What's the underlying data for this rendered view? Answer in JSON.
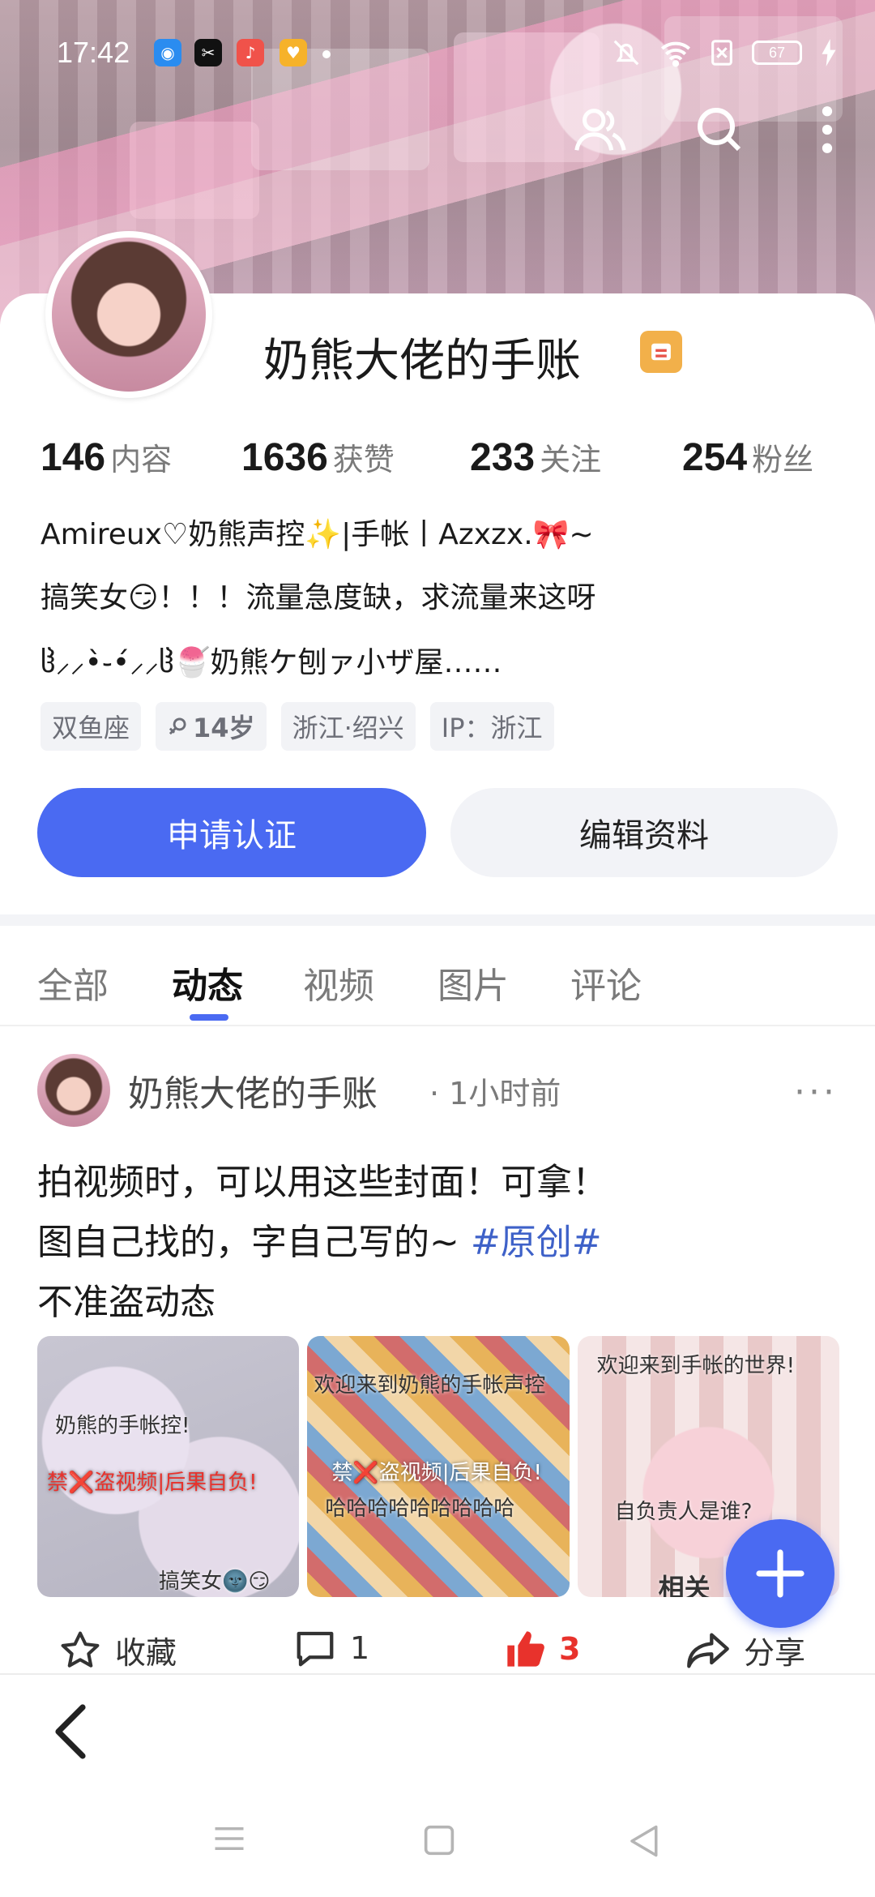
{
  "status_bar": {
    "time": "17:42",
    "battery": "67",
    "icons": [
      "mute-icon",
      "wifi-icon",
      "sim-icon",
      "battery-icon",
      "charging-icon"
    ],
    "app_icons": [
      "browser-app-icon",
      "capcut-app-icon",
      "music-app-icon",
      "heart-app-icon"
    ]
  },
  "header": {
    "actions": [
      "friends-icon",
      "search-icon",
      "more-vert-icon"
    ]
  },
  "profile": {
    "name": "奶熊大佬的手账",
    "stats": [
      {
        "value": "146",
        "label": "内容"
      },
      {
        "value": "1636",
        "label": "获赞"
      },
      {
        "value": "233",
        "label": "关注"
      },
      {
        "value": "254",
        "label": "粉丝"
      }
    ],
    "bio": [
      "Amireux♡奶熊声控✨|手帐丨Azxzx.🎀~",
      "搞笑女😏！！！流量急度缺，求流量来这呀",
      "ჱ̒⸝⸝•̀֊•́⸝⸝ჱ̒🍧奶熊ケ刨ァ小ザ屋……"
    ],
    "tags": [
      {
        "label": "双鱼座"
      },
      {
        "label": "14岁",
        "icon": "gender-icon"
      },
      {
        "label": "浙江·绍兴"
      },
      {
        "label": "IP：浙江"
      }
    ],
    "primary_button": "申请认证",
    "secondary_button": "编辑资料"
  },
  "tabs": {
    "items": [
      "全部",
      "动态",
      "视频",
      "图片",
      "评论"
    ],
    "active": "动态"
  },
  "post": {
    "author": "奶熊大佬的手账",
    "time": "· 1小时前",
    "more": "···",
    "lines": [
      "拍视频时，可以用这些封面！可拿！",
      "图自己找的，字自己写的~",
      "不准盗动态"
    ],
    "hashtag": "#原创#",
    "images": [
      {
        "caption_top": "奶熊的手帐控!",
        "caption_mid": "禁❌盗视频|后果自负!",
        "caption_bottom": "搞笑女🌚😏"
      },
      {
        "caption_top": "欢迎来到奶熊的手帐声控",
        "caption_mid": "禁❌盗视频|后果自负!",
        "caption_bottom": "哈哈哈哈哈哈哈哈哈"
      },
      {
        "caption_top": "欢迎来到手帐的世界!",
        "caption_mid": "自负责人是谁?",
        "caption_bottom": "相关"
      }
    ],
    "actions": {
      "collect": "收藏",
      "comment_count": "1",
      "like_count": "3",
      "share": "分享"
    }
  },
  "colors": {
    "accent": "#4a6af2",
    "like": "#e8322c",
    "hashtag": "#3e61c8"
  }
}
